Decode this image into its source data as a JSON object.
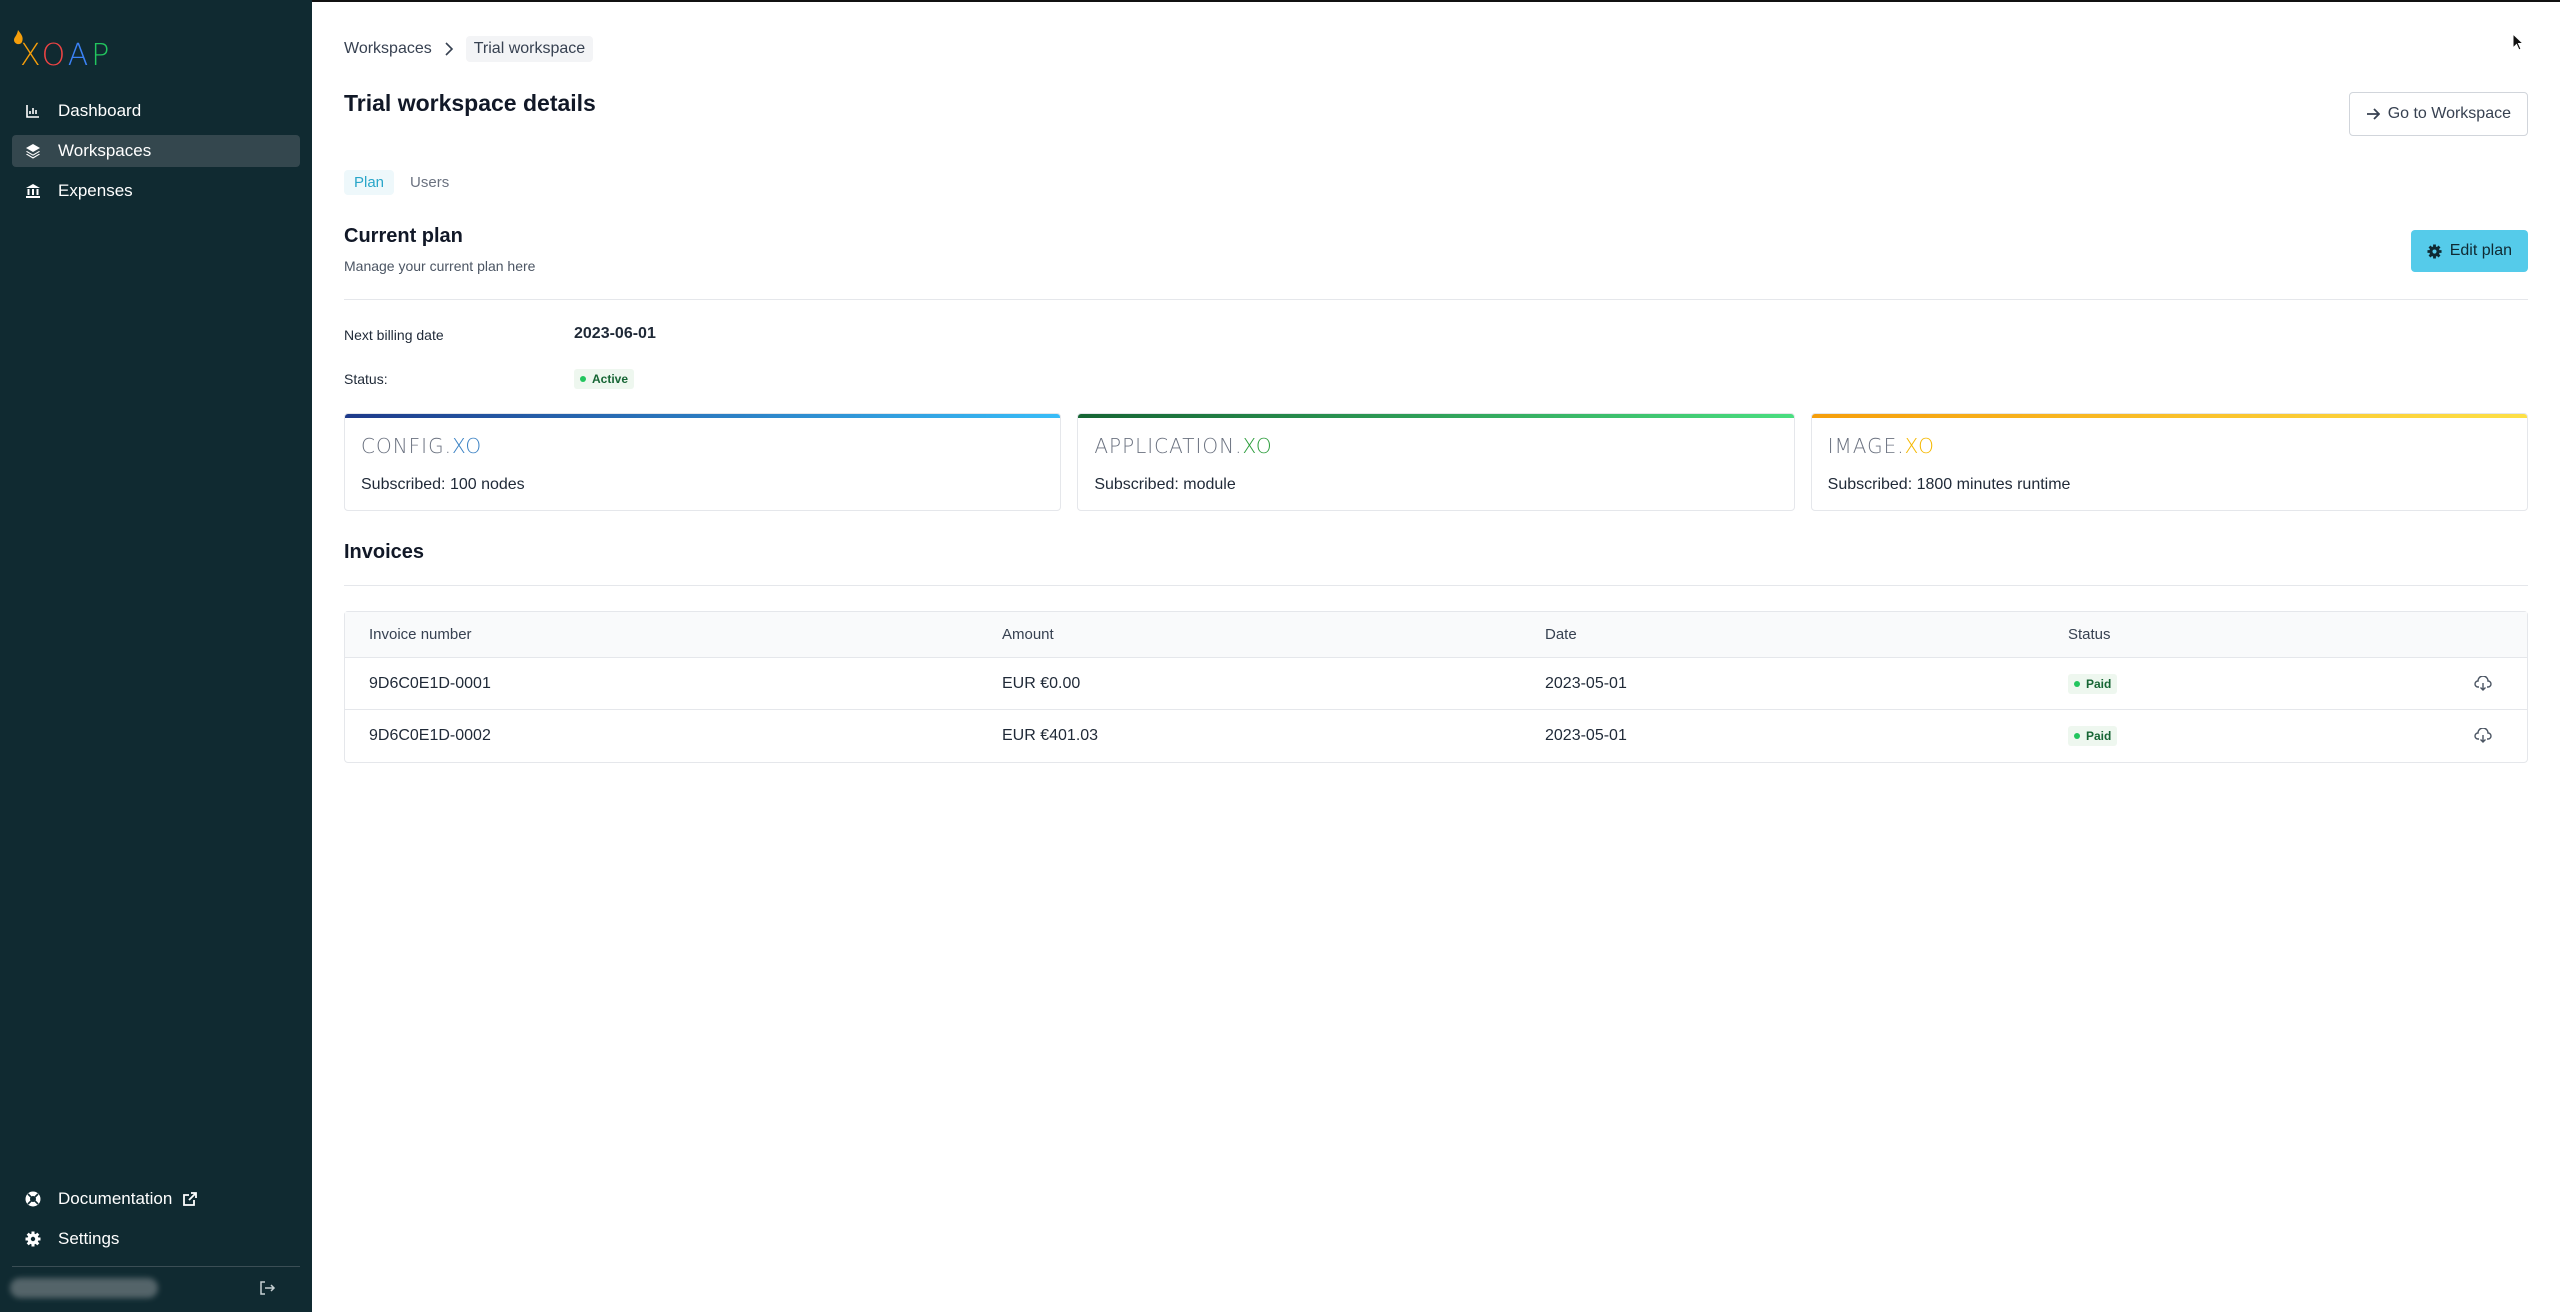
{
  "brand": {
    "logo_text": "XOAP",
    "logo_letters": [
      "X",
      "O",
      "A",
      "P"
    ]
  },
  "sidebar": {
    "items": [
      {
        "label": "Dashboard",
        "icon": "chart-icon"
      },
      {
        "label": "Workspaces",
        "icon": "layers-icon",
        "active": true
      },
      {
        "label": "Expenses",
        "icon": "bank-icon"
      }
    ],
    "bottom_items": [
      {
        "label": "Documentation",
        "icon": "help-circle-icon"
      },
      {
        "label": "Settings",
        "icon": "gear-icon"
      }
    ]
  },
  "breadcrumb": {
    "parent": "Workspaces",
    "current": "Trial workspace"
  },
  "page": {
    "title": "Trial workspace details",
    "go_to_workspace": "Go to Workspace"
  },
  "tabs": [
    {
      "label": "Plan",
      "active": true
    },
    {
      "label": "Users",
      "active": false
    }
  ],
  "plan": {
    "title": "Current plan",
    "subtitle": "Manage your current plan here",
    "edit_button": "Edit plan",
    "next_billing_label": "Next billing date",
    "next_billing_value": "2023-06-01",
    "status_label": "Status:",
    "status_value": "Active",
    "products": [
      {
        "name_a": "CONFIG.",
        "name_b": "XO",
        "accent": "#3b82c4",
        "bar": [
          "#1e3a8a",
          "#38bdf8"
        ],
        "subscribed": "Subscribed: 100 nodes"
      },
      {
        "name_a": "APPLICATION.",
        "name_b": "XO",
        "accent": "#2e9e3e",
        "bar": [
          "#166534",
          "#4ade80"
        ],
        "subscribed": "Subscribed: module"
      },
      {
        "name_a": "IMAGE.",
        "name_b": "XO",
        "accent": "#f5b800",
        "bar": [
          "#f59e0b",
          "#fde047"
        ],
        "subscribed": "Subscribed: 1800 minutes runtime"
      }
    ]
  },
  "invoices": {
    "title": "Invoices",
    "columns": [
      "Invoice number",
      "Amount",
      "Date",
      "Status"
    ],
    "rows": [
      {
        "number": "9D6C0E1D-0001",
        "amount": "EUR €0.00",
        "date": "2023-05-01",
        "status": "Paid"
      },
      {
        "number": "9D6C0E1D-0002",
        "amount": "EUR €401.03",
        "date": "2023-05-01",
        "status": "Paid"
      }
    ]
  },
  "colors": {
    "sidebar_bg": "#102a31",
    "accent": "#55cbea",
    "paid_badge": "#22c55e"
  }
}
